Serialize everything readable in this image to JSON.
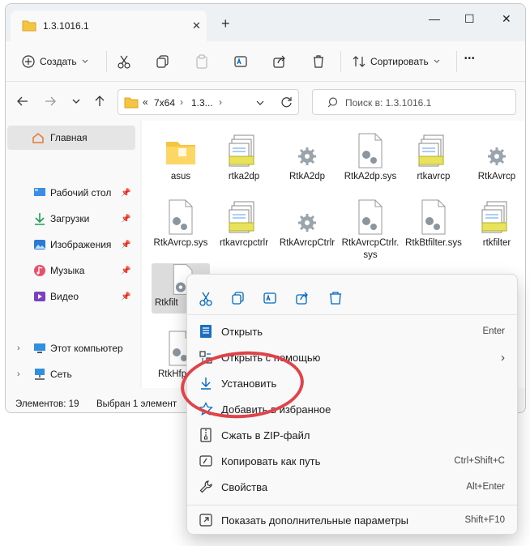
{
  "window": {
    "tab_title": "1.3.1016.1",
    "tab_close": "✕",
    "tab_add": "+",
    "min": "—",
    "max": "☐",
    "close": "✕"
  },
  "toolbar": {
    "create_label": "Создать",
    "sort_label": "Сортировать",
    "more": "•••"
  },
  "address": {
    "path_prefix": "«",
    "crumb1": "7x64",
    "crumb_sep": "›",
    "crumb2": "1.3...",
    "search_placeholder": "Поиск в: 1.3.1016.1"
  },
  "sidebar": {
    "home": "Главная",
    "desktop": "Рабочий стол",
    "downloads": "Загрузки",
    "pictures": "Изображения",
    "music": "Музыка",
    "video": "Видео",
    "this_pc": "Этот компьютер",
    "network": "Сеть"
  },
  "files": [
    {
      "name": "asus",
      "type": "folder"
    },
    {
      "name": "rtka2dp",
      "type": "stack"
    },
    {
      "name": "RtkA2dp",
      "type": "gear"
    },
    {
      "name": "RtkA2dp.sys",
      "type": "doc"
    },
    {
      "name": "rtkavrcp",
      "type": "stack"
    },
    {
      "name": "RtkAvrcp",
      "type": "gear"
    },
    {
      "name": "RtkAvrcp.sys",
      "type": "doc"
    },
    {
      "name": "rtkavrcpctrlr",
      "type": "stack"
    },
    {
      "name": "RtkAvrcpCtrlr",
      "type": "gear"
    },
    {
      "name": "RtkAvrcpCtrlr.sys",
      "type": "doc"
    },
    {
      "name": "RtkBtfilter.sys",
      "type": "doc"
    },
    {
      "name": "rtkfilter",
      "type": "stack"
    },
    {
      "name": "Rtkfilt",
      "type": "gear"
    },
    {
      "name": "RtkHfp",
      "type": "doc"
    }
  ],
  "status": {
    "count": "Элементов: 19",
    "selected": "Выбран 1 элемент"
  },
  "context_menu": {
    "items": [
      {
        "label": "Открыть",
        "shortcut": "Enter"
      },
      {
        "label": "Открыть с помощью",
        "shortcut": "›"
      },
      {
        "label": "Установить",
        "shortcut": ""
      },
      {
        "label": "Добавить в избранное",
        "shortcut": ""
      },
      {
        "label": "Сжать в ZIP-файл",
        "shortcut": ""
      },
      {
        "label": "Копировать как путь",
        "shortcut": "Ctrl+Shift+C"
      },
      {
        "label": "Свойства",
        "shortcut": "Alt+Enter"
      },
      {
        "label": "Показать дополнительные параметры",
        "shortcut": "Shift+F10"
      }
    ]
  },
  "colors": {
    "accent": "#0067c0",
    "highlight_ring": "#e0444a",
    "folder": "#f5c542"
  }
}
